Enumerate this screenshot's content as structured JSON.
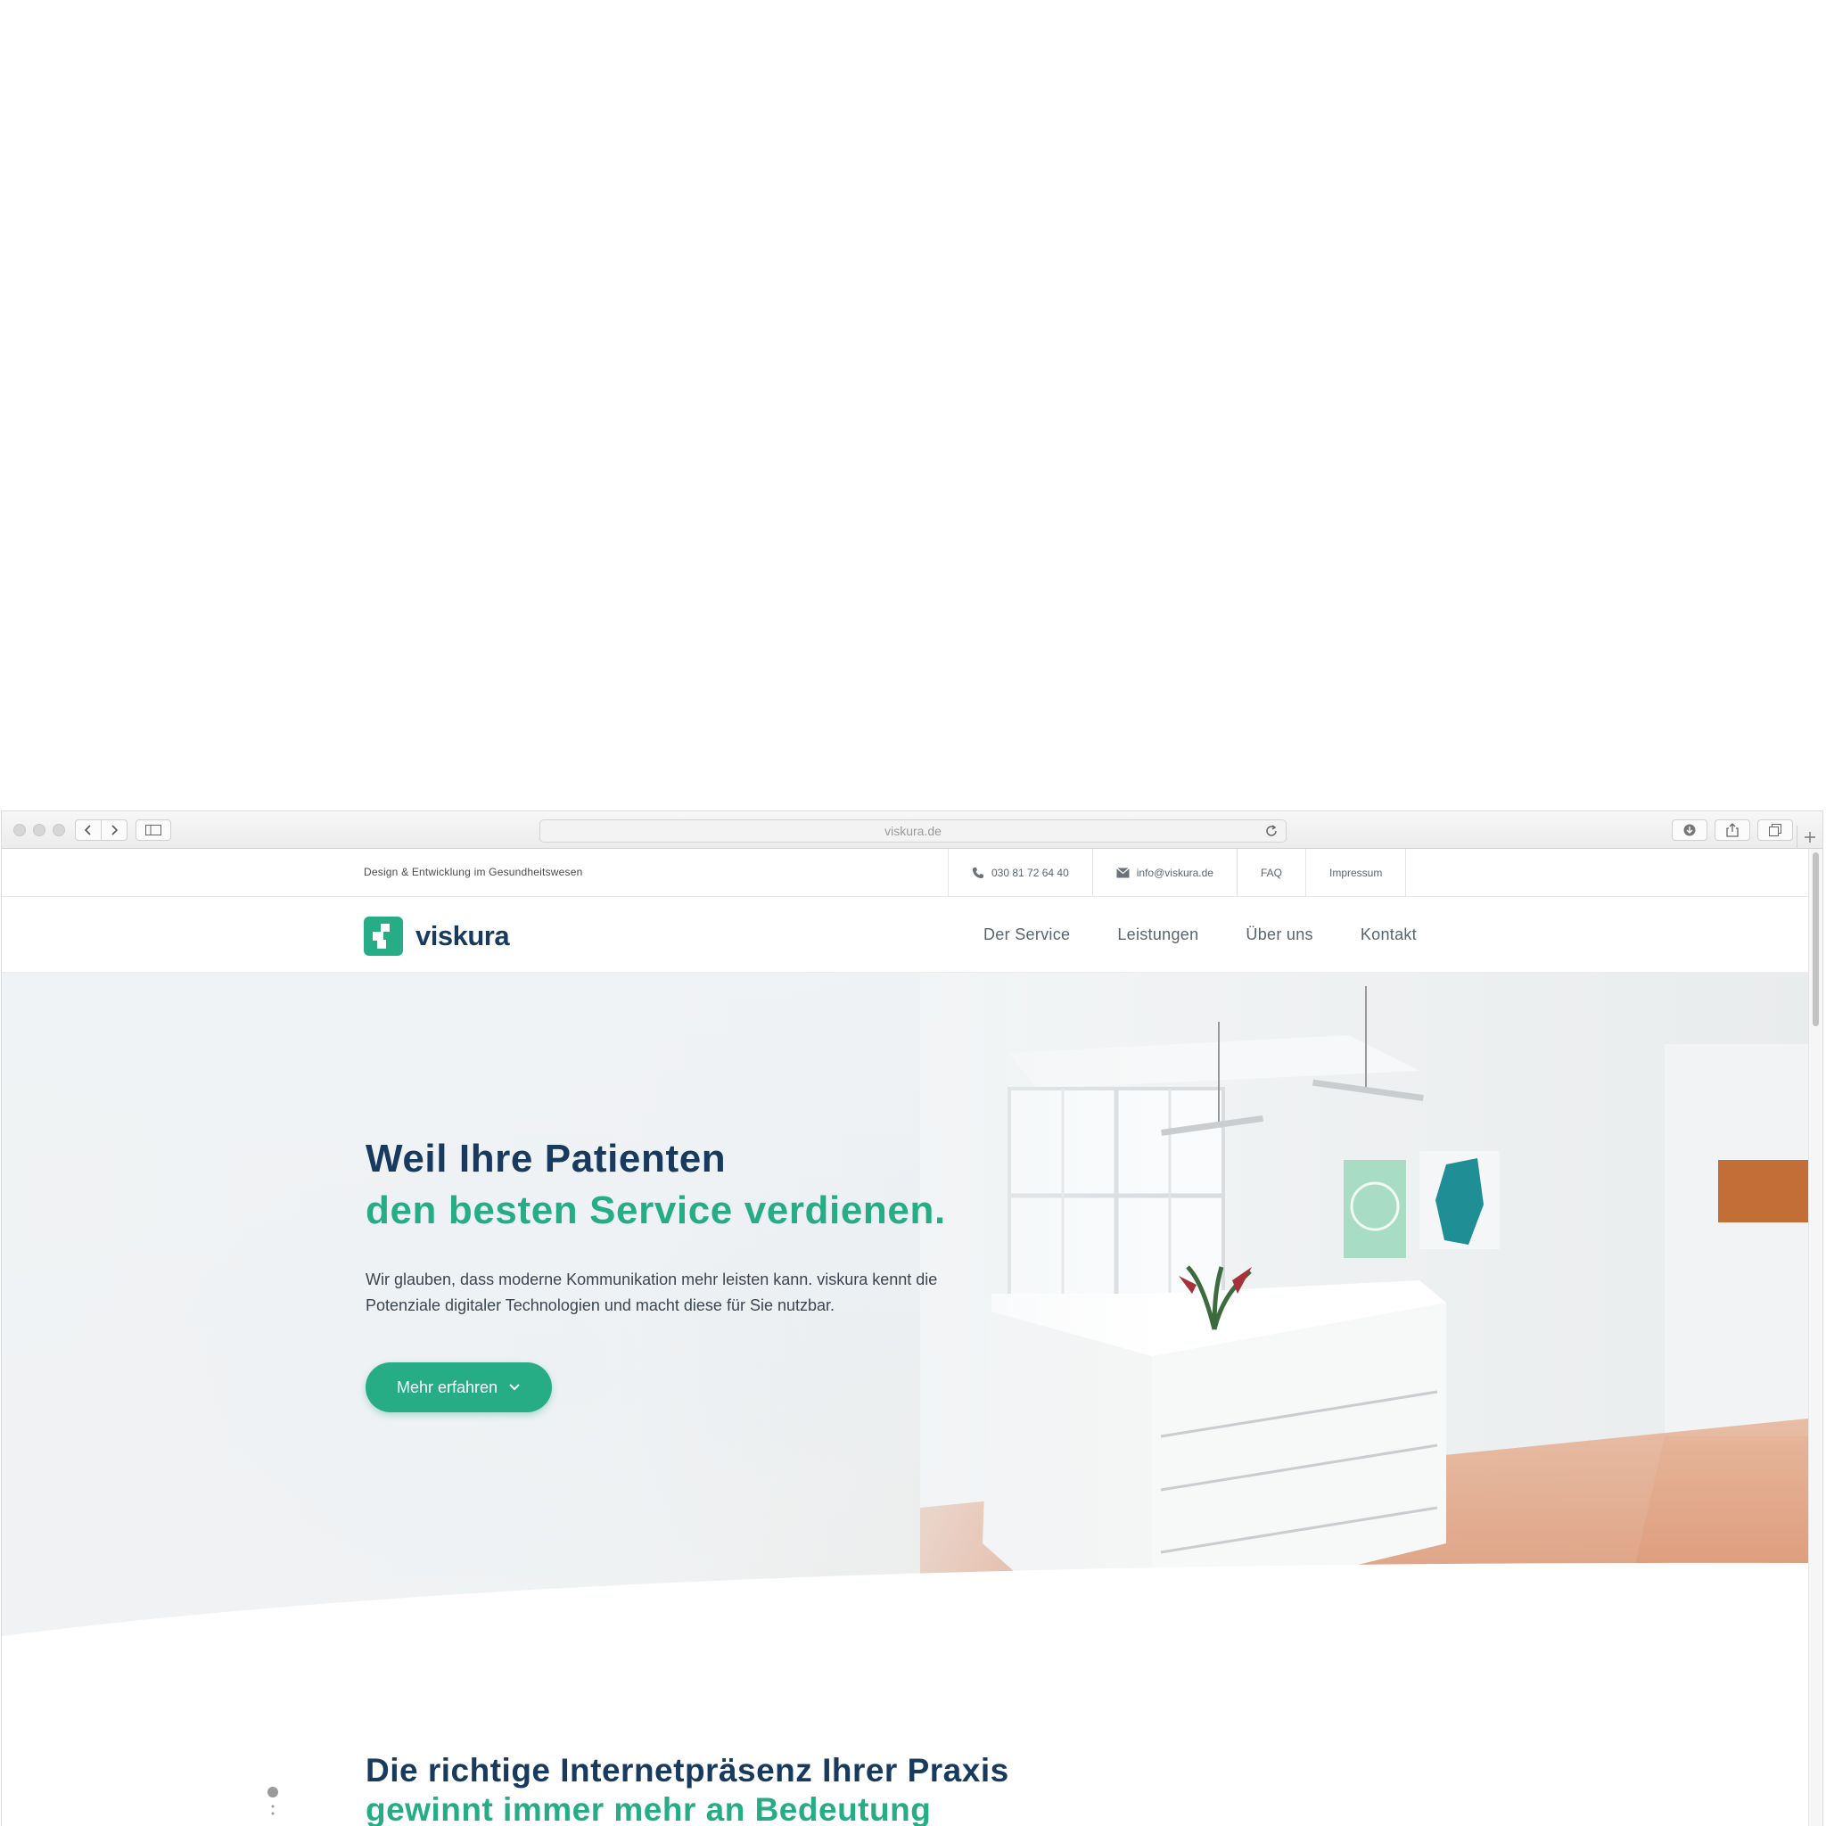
{
  "browser": {
    "url": "viskura.de"
  },
  "topbar": {
    "tagline": "Design & Entwicklung im Gesundheitswesen",
    "phone": "030 81 72 64 40",
    "email": "info@viskura.de",
    "faq": "FAQ",
    "impressum": "Impressum"
  },
  "brand": {
    "name": "viskura",
    "color": "#27ad86",
    "dark": "#173a5e"
  },
  "nav": {
    "items": [
      "Der Service",
      "Leistungen",
      "Über uns",
      "Kontakt"
    ]
  },
  "hero": {
    "title_line1": "Weil Ihre Patienten",
    "title_line2": "den besten Service verdienen.",
    "text": "Wir glauben, dass moderne Kommunikation mehr leisten kann. viskura kennt die Potenziale digitaler Technologien und macht diese für Sie nutzbar.",
    "button": "Mehr erfahren"
  },
  "section": {
    "title_line1": "Die richtige Internetpräsenz Ihrer Praxis",
    "title_line2": "gewinnt immer mehr an Bedeutung"
  }
}
